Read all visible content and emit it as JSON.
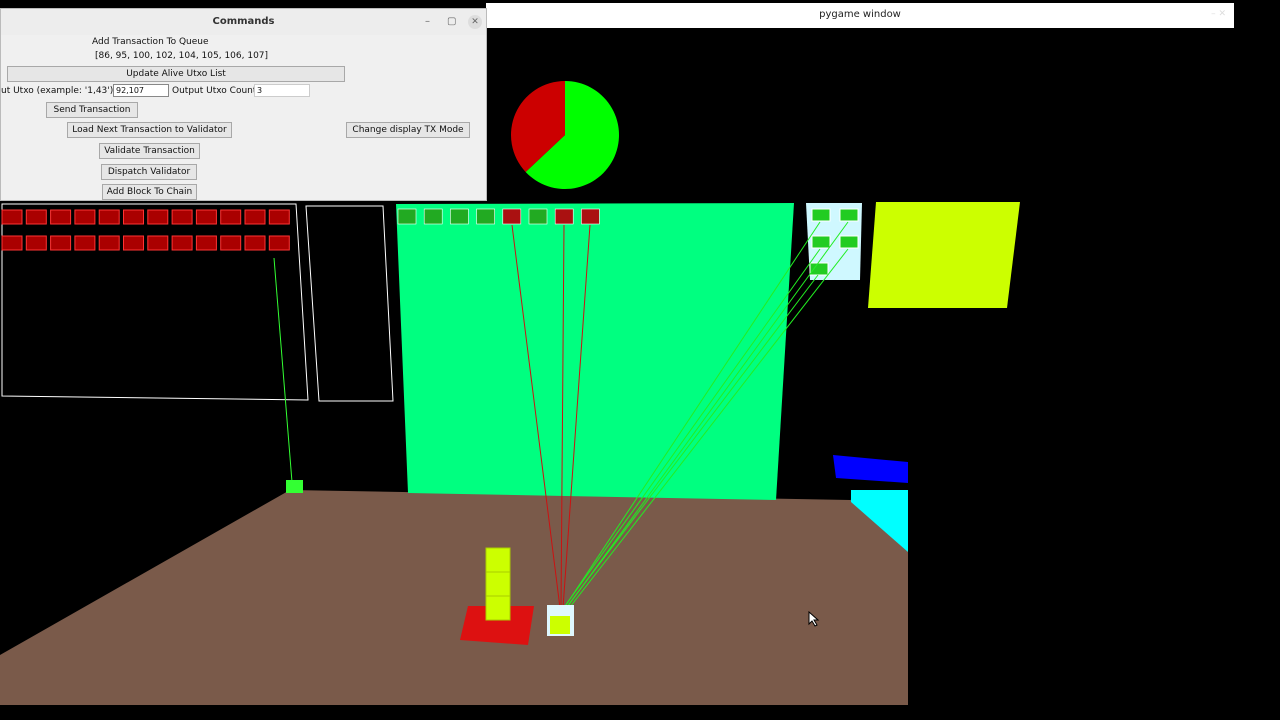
{
  "pygame_window": {
    "title": "pygame window"
  },
  "commands": {
    "title": "Commands",
    "add_tx_heading": "Add Transaction To Queue",
    "alive_utxos": "[86, 95, 100, 102, 104, 105, 106, 107]",
    "update_alive_btn": "Update Alive Utxo List",
    "input_utxo_label": "ut Utxo (example: '1,43')",
    "input_utxo_value": "92,107",
    "output_count_label": "Output Utxo Count",
    "output_count_value": "3",
    "send_btn": "Send Transaction",
    "load_next_btn": "Load Next Transaction to Validator",
    "change_mode_btn": "Change display TX Mode",
    "validate_btn": "Validate Transaction",
    "dispatch_btn": "Dispatch Validator",
    "add_block_btn": "Add Block To Chain"
  },
  "scene": {
    "pie": {
      "green_fraction": 0.63,
      "red_fraction": 0.37,
      "colors": [
        "#00ff00",
        "#cc0000"
      ]
    },
    "colors": {
      "floor": "#7a5a4a",
      "panel": "#00ff80",
      "yellow": "#ccff00",
      "red": "#cc0000",
      "blue": "#0000ff",
      "cyan": "#00ffff"
    },
    "queue_row1_count": 12,
    "queue_row2_count": 12,
    "panel_tx_count": 8,
    "tower_cubes": 3
  },
  "cursor": {
    "icon": "mouse-pointer-icon"
  }
}
